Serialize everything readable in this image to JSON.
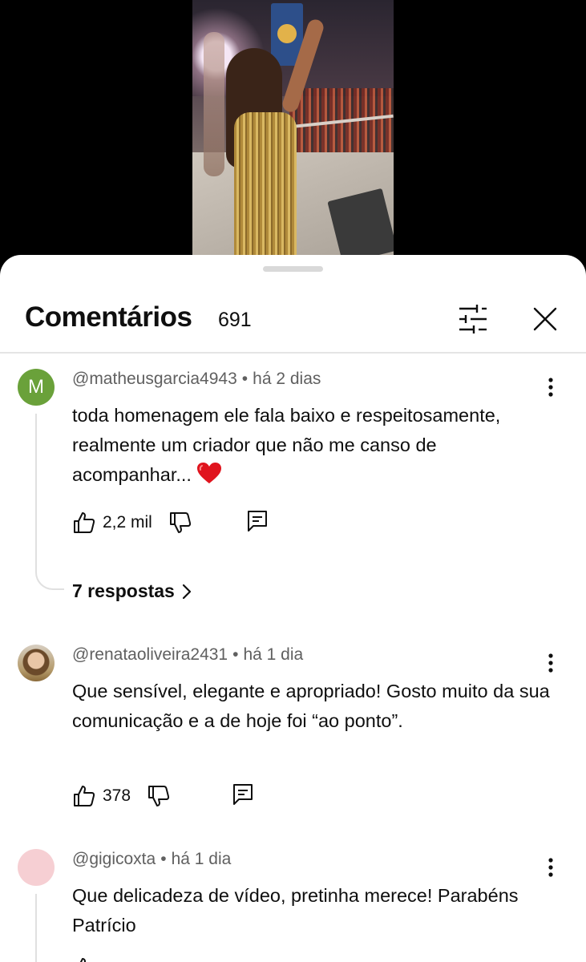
{
  "video": {
    "description_icon": "concert-video-frame"
  },
  "sheet": {
    "title": "Comentários",
    "count": "691",
    "filter_icon": "sliders-icon",
    "close_icon": "close-icon"
  },
  "comments": [
    {
      "avatar_letter": "M",
      "avatar_color": "#6aa13a",
      "author": "@matheusgarcia4943",
      "separator": "•",
      "time": "há 2 dias",
      "text": "toda homenagem ele fala baixo e respeitosamente, realmente um criador que não me canso de acompanhar... ",
      "likes": "2,2 mil",
      "replies": "7 respostas"
    },
    {
      "author": "@renataoliveira2431",
      "separator": "•",
      "time": "há 1 dia",
      "text": "Que sensível, elegante e apropriado! Gosto muito da sua comunicação e a de hoje foi “ao ponto”.",
      "likes": "378"
    },
    {
      "avatar_color": "#f6cfd3",
      "author": "@gigicoxta",
      "separator": "•",
      "time": "há 1 dia",
      "text": "Que delicadeza de vídeo, pretinha merece! Parabéns Patrício"
    }
  ]
}
